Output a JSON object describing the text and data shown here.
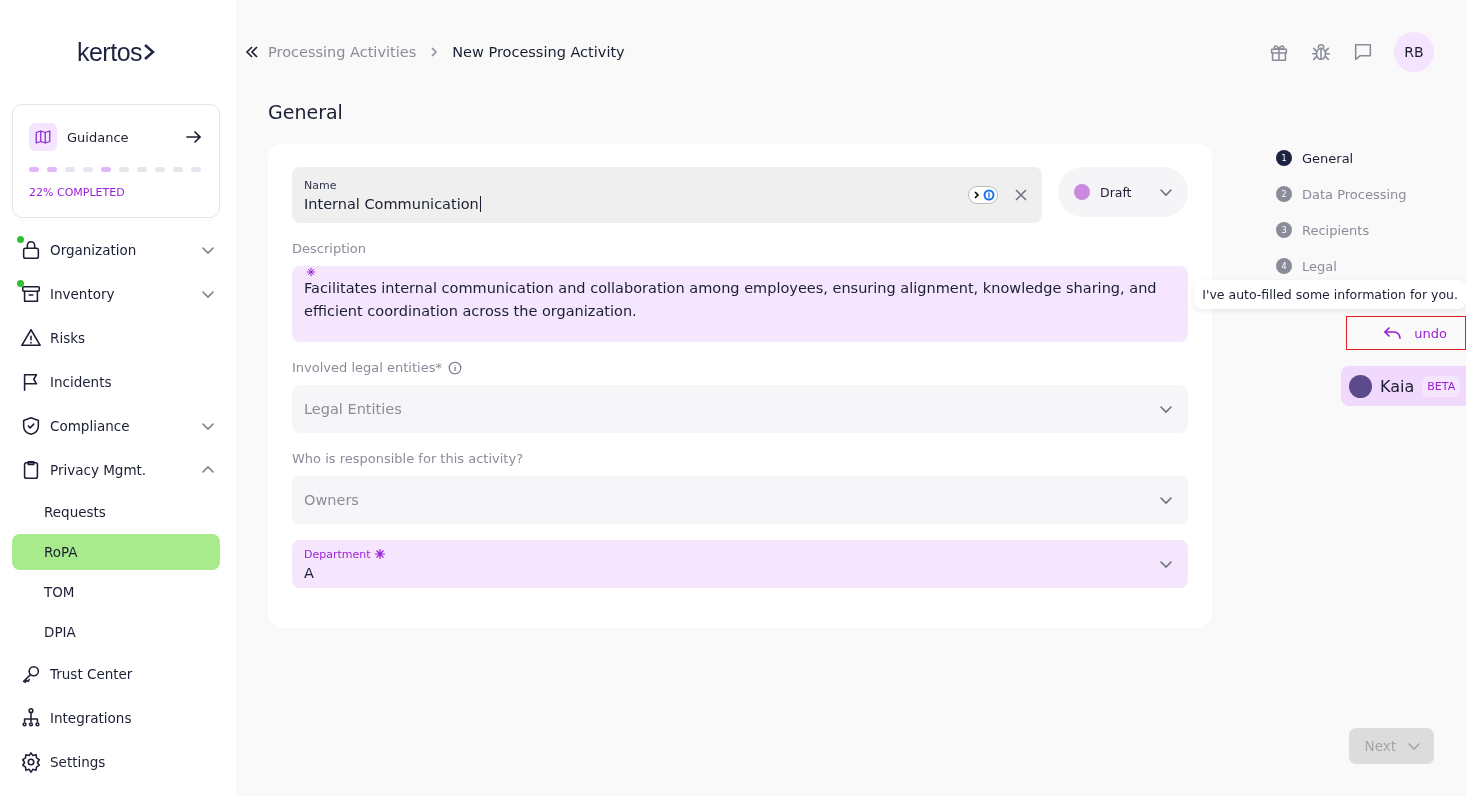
{
  "logo": {
    "text": "kertos"
  },
  "guidance": {
    "title": "Guidance",
    "progress_label": "22% COMPLETED",
    "steps": [
      {
        "done": true
      },
      {
        "done": true
      },
      {
        "done": false
      },
      {
        "done": false
      },
      {
        "done": true
      },
      {
        "done": false
      },
      {
        "done": false
      },
      {
        "done": false
      },
      {
        "done": false
      },
      {
        "done": false
      }
    ]
  },
  "sidebar": {
    "items": [
      {
        "label": "Organization",
        "expandable": true,
        "expanded": false,
        "notification": true,
        "selected": false
      },
      {
        "label": "Inventory",
        "expandable": true,
        "expanded": false,
        "notification": true,
        "selected": false
      },
      {
        "label": "Risks",
        "expandable": false,
        "notification": false,
        "selected": false
      },
      {
        "label": "Incidents",
        "expandable": false,
        "notification": false,
        "selected": false
      },
      {
        "label": "Compliance",
        "expandable": true,
        "expanded": false,
        "notification": false,
        "selected": false
      },
      {
        "label": "Privacy Mgmt.",
        "expandable": true,
        "expanded": true,
        "notification": false,
        "selected": false,
        "children": [
          {
            "label": "Requests",
            "selected": false
          },
          {
            "label": "RoPA",
            "selected": true
          },
          {
            "label": "TOM",
            "selected": false
          },
          {
            "label": "DPIA",
            "selected": false
          }
        ]
      },
      {
        "label": "Trust Center",
        "expandable": false,
        "notification": false,
        "selected": false
      },
      {
        "label": "Integrations",
        "expandable": false,
        "notification": false,
        "selected": false
      },
      {
        "label": "Settings",
        "expandable": false,
        "notification": false,
        "selected": false
      }
    ]
  },
  "breadcrumb": [
    "Processing Activities",
    "New Processing Activity"
  ],
  "user": {
    "initials": "RB"
  },
  "heading": "General",
  "status": {
    "label": "Draft",
    "color": "#c98ae0"
  },
  "fields": [
    {
      "kind": "text",
      "label": "Name",
      "value": "Internal Communication",
      "ai_filled": false
    },
    {
      "kind": "textarea",
      "label": "Description",
      "value": "Facilitates internal communication and collaboration among employees, ensuring alignment, knowledge sharing, and efficient coordination across the organization.",
      "ai_filled": true
    },
    {
      "kind": "select",
      "label": "Involved legal entities*",
      "placeholder": "Legal Entities",
      "info": true,
      "ai_filled": false
    },
    {
      "kind": "select",
      "label": "Who is responsible for this activity?",
      "placeholder": "Owners",
      "info": false,
      "ai_filled": false
    },
    {
      "kind": "select",
      "label": "Department",
      "value": "A",
      "ai_filled": true
    }
  ],
  "steps": [
    {
      "number": "1",
      "label": "General",
      "selected": true
    },
    {
      "number": "2",
      "label": "Data Processing",
      "selected": false
    },
    {
      "number": "3",
      "label": "Recipients",
      "selected": false
    },
    {
      "number": "4",
      "label": "Legal",
      "selected": false
    }
  ],
  "assistant": {
    "message": "I've auto-filled some information for you.",
    "undo": "undo",
    "name": "Kaia",
    "badge": "BETA"
  },
  "next": {
    "label": "Next",
    "disabled": true
  }
}
